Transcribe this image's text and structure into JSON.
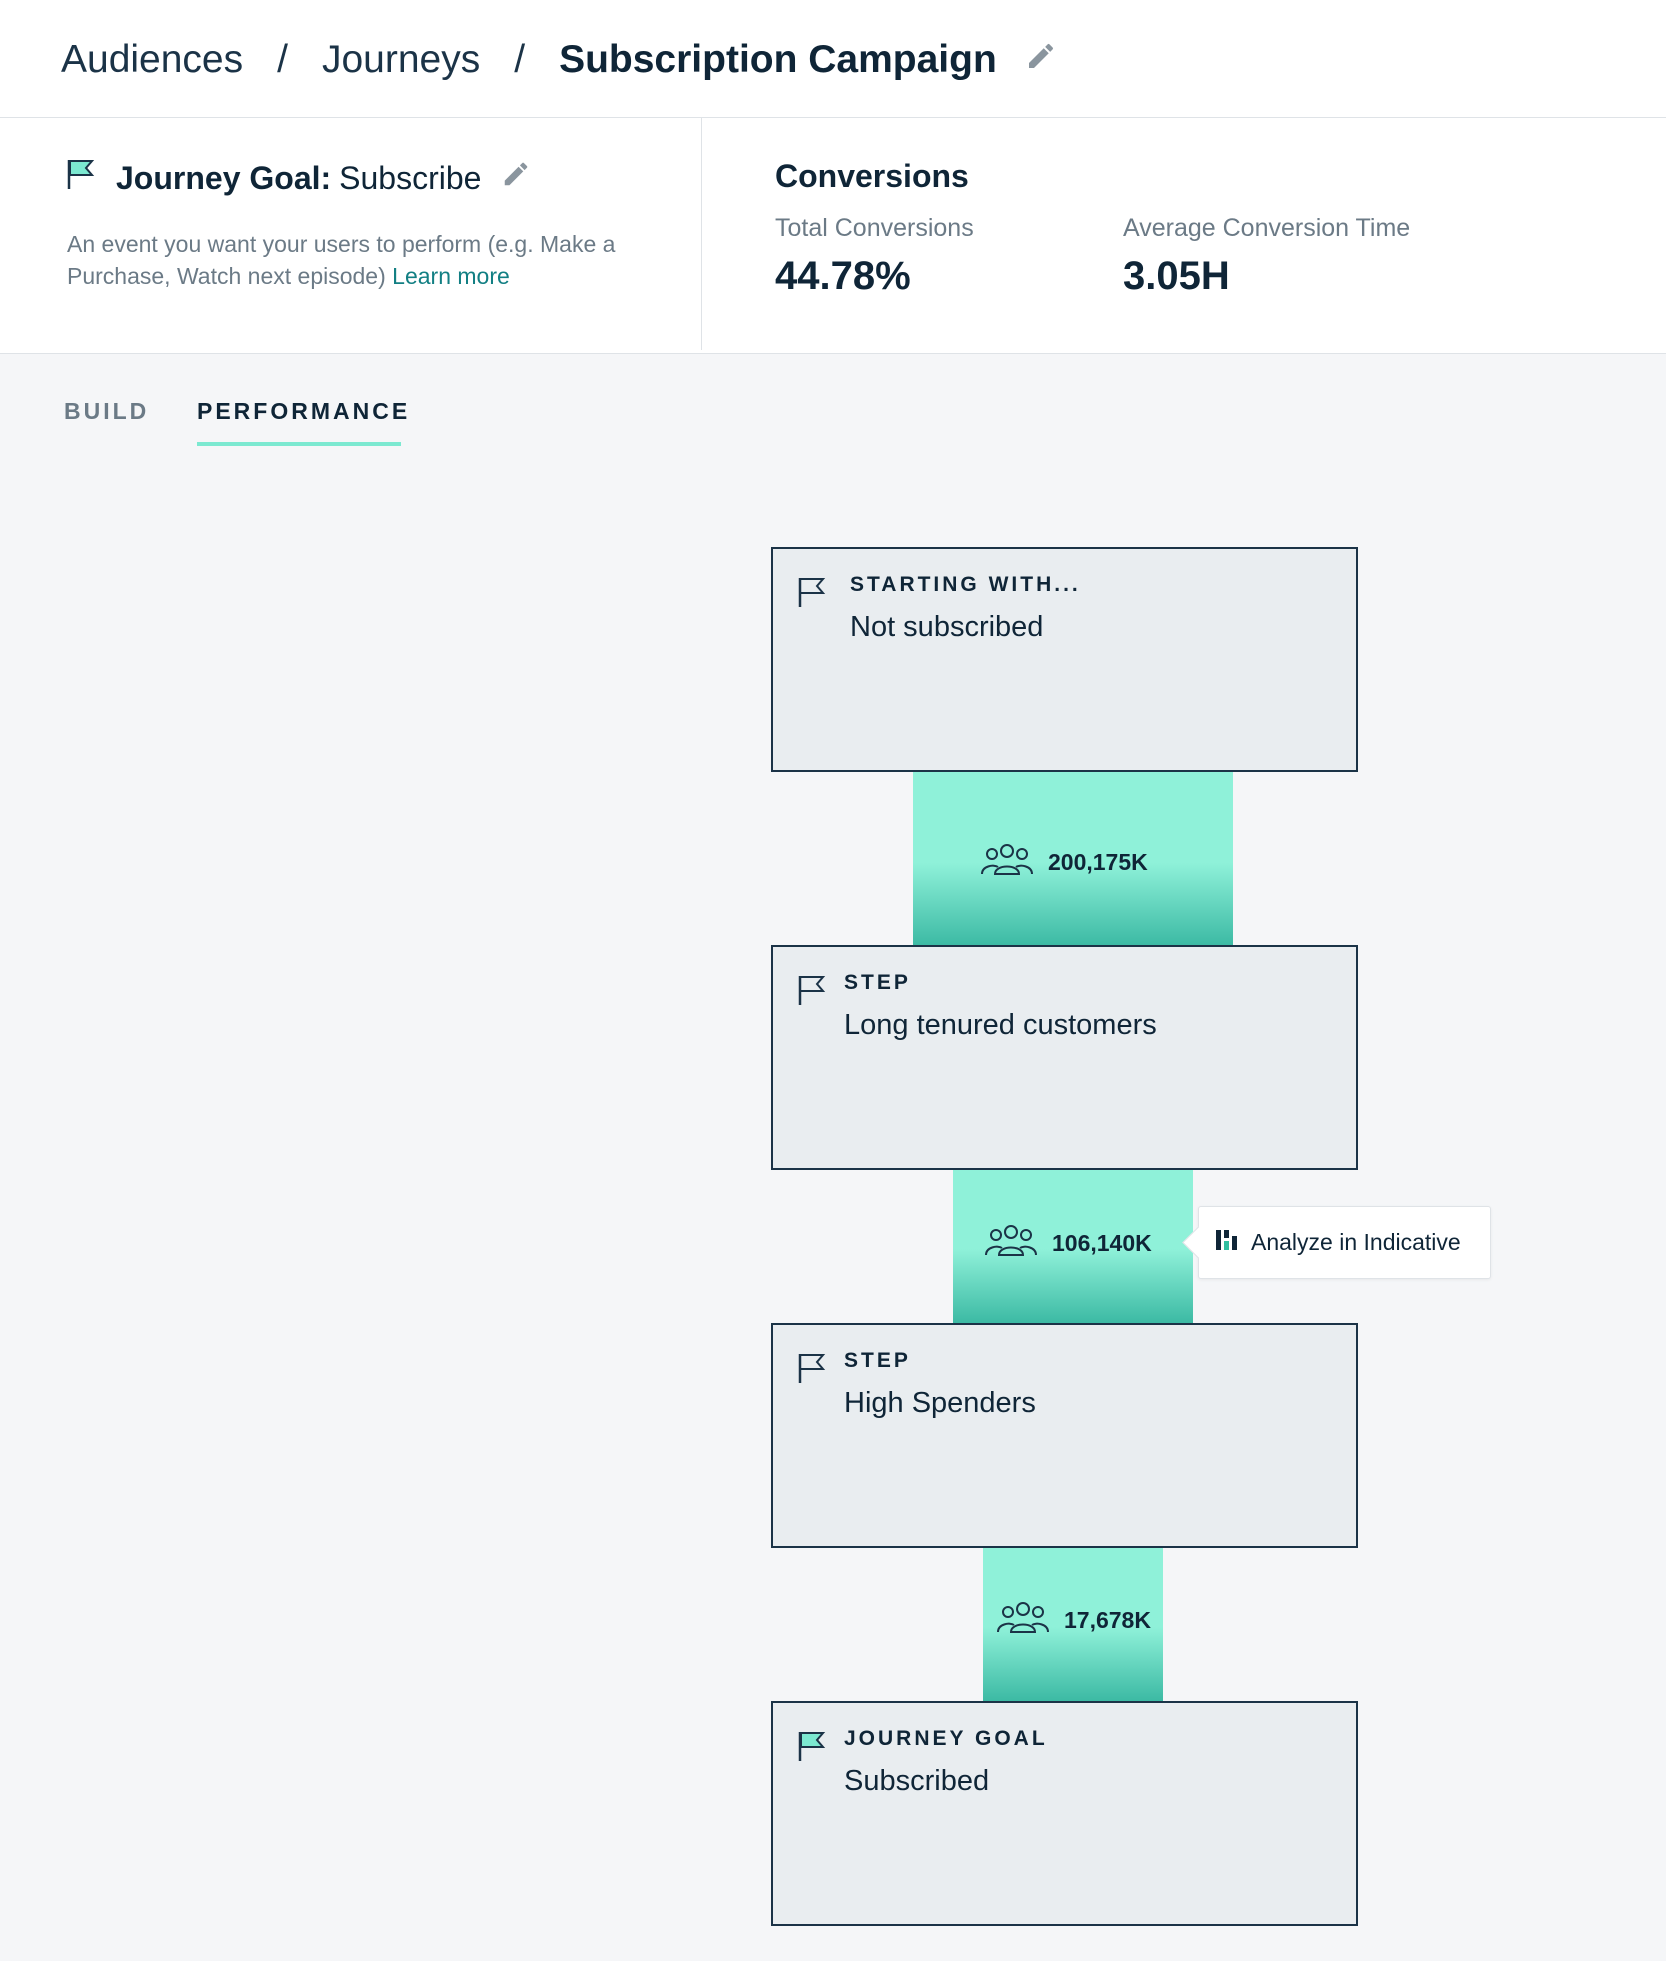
{
  "breadcrumb": {
    "items": [
      "Audiences",
      "Journeys"
    ],
    "separator": "/",
    "current": "Subscription Campaign"
  },
  "goal": {
    "label": "Journey Goal:",
    "value": "Subscribe",
    "description": "An event you want your users to perform (e.g. Make a Purchase, Watch next episode)",
    "learn_more": "Learn more"
  },
  "conversions": {
    "title": "Conversions",
    "total_label": "Total Conversions",
    "total_value": "44.78%",
    "avg_label": "Average Conversion Time",
    "avg_value": "3.05H"
  },
  "tabs": [
    {
      "label": "BUILD",
      "active": false
    },
    {
      "label": "PERFORMANCE",
      "active": true
    }
  ],
  "journey": {
    "nodes": [
      {
        "label": "STARTING WITH...",
        "value": "Not subscribed",
        "flag": "outline-flag-icon"
      },
      {
        "label": "STEP",
        "value": "Long tenured customers",
        "flag": "outline-flag-icon"
      },
      {
        "label": "STEP",
        "value": "High Spenders",
        "flag": "outline-flag-icon"
      },
      {
        "label": "JOURNEY GOAL",
        "value": "Subscribed",
        "flag": "teal-flag-icon"
      }
    ],
    "connectors": [
      {
        "count": "200,175K"
      },
      {
        "count": "106,140K"
      },
      {
        "count": "17,678K"
      }
    ],
    "tooltip": {
      "label": "Analyze in Indicative"
    }
  },
  "colors": {
    "accent": "#7ce9d1",
    "connector_top": "#8ff1d9",
    "connector_bottom": "#3bb9a3",
    "link": "#127f83",
    "text_dark": "#0f2537",
    "text_muted": "#6b7a86"
  }
}
